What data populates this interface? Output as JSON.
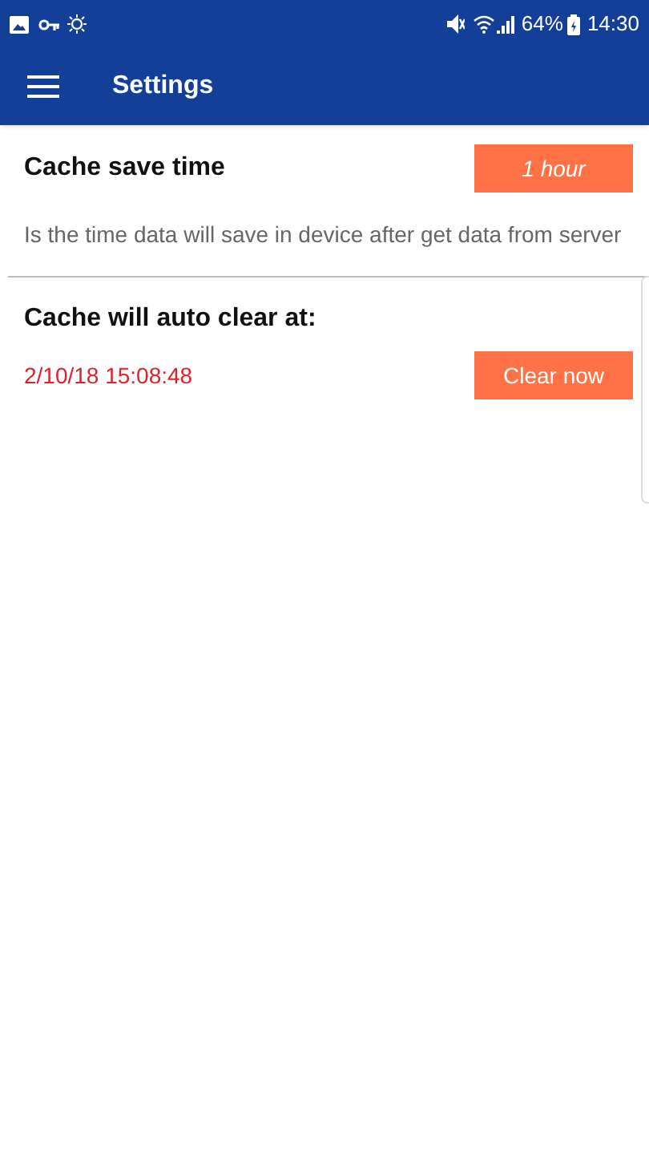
{
  "status_bar": {
    "battery": "64%",
    "time": "14:30"
  },
  "app_bar": {
    "title": "Settings"
  },
  "sections": [
    {
      "title": "Cache save time",
      "button": {
        "label": "1 hour",
        "italic": true
      },
      "description": "Is the time data will save in device after get data from server"
    },
    {
      "title": "Cache will auto clear at:",
      "value": "2/10/18 15:08:48",
      "button": {
        "label": "Clear now",
        "italic": false
      }
    }
  ]
}
